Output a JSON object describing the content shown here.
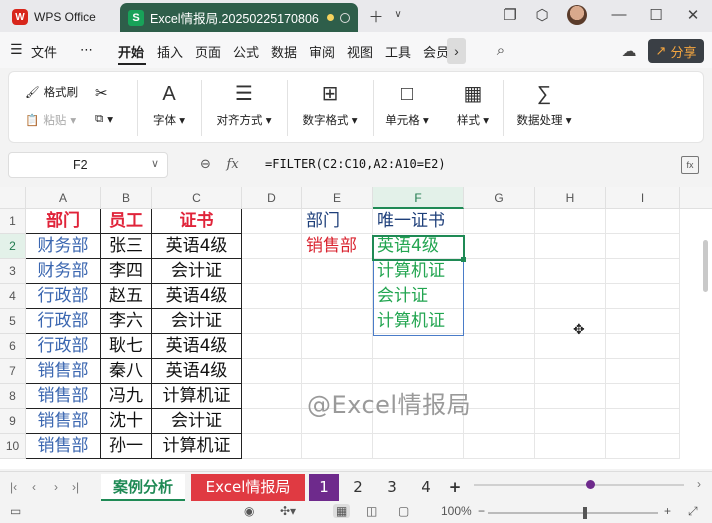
{
  "titlebar": {
    "app_name": "WPS Office",
    "doc_tab": "Excel情报局.20250225170806",
    "icons": [
      "new-tab-icon",
      "dropdown-icon",
      "restore-icon",
      "cube-icon",
      "avatar",
      "minimize-icon",
      "maximize-icon",
      "close-icon"
    ]
  },
  "menubar": {
    "file": "文件",
    "more": "⋯",
    "items": [
      "开始",
      "插入",
      "页面",
      "公式",
      "数据",
      "审阅",
      "视图",
      "工具",
      "会员"
    ],
    "share": "分享"
  },
  "ribbon": {
    "format_painter": "格式刷",
    "paste": "粘贴",
    "font": "字体",
    "align": "对齐方式",
    "number_format": "数字格式",
    "cell": "单元格",
    "style": "样式",
    "data_process": "数据处理"
  },
  "formula_bar": {
    "cell_ref": "F2",
    "fx": "fx",
    "formula": "=FILTER(C2:C10,A2:A10=E2)"
  },
  "grid": {
    "columns": [
      "A",
      "B",
      "C",
      "D",
      "E",
      "F",
      "G",
      "H",
      "I"
    ],
    "rows": [
      "1",
      "2",
      "3",
      "4",
      "5",
      "6",
      "7",
      "8",
      "9",
      "10"
    ],
    "table_headers": [
      "部门",
      "员工",
      "证书"
    ],
    "table_rows": [
      [
        "财务部",
        "张三",
        "英语4级"
      ],
      [
        "财务部",
        "李四",
        "会计证"
      ],
      [
        "行政部",
        "赵五",
        "英语4级"
      ],
      [
        "行政部",
        "李六",
        "会计证"
      ],
      [
        "行政部",
        "耿七",
        "英语4级"
      ],
      [
        "销售部",
        "秦八",
        "英语4级"
      ],
      [
        "销售部",
        "冯九",
        "计算机证"
      ],
      [
        "销售部",
        "沈十",
        "会计证"
      ],
      [
        "销售部",
        "孙一",
        "计算机证"
      ]
    ],
    "e1": "部门",
    "e2": "销售部",
    "f1": "唯一证书",
    "f_results": [
      "英语4级",
      "计算机证",
      "会计证",
      "计算机证"
    ],
    "watermark": "@Excel情报局"
  },
  "sheet_tabs": {
    "tabs": [
      "案例分析",
      "Excel情报局",
      "1",
      "2",
      "3",
      "4"
    ],
    "add": "+"
  },
  "statusbar": {
    "zoom": "100%",
    "zoom_out": "−",
    "zoom_in": "+"
  },
  "colors": {
    "accent_green": "#1f8a55",
    "header_red": "#e0243a",
    "dept_blue": "#3a66b0",
    "result_green": "#22a550",
    "tab_red": "#e03a42",
    "tab_purple": "#6e2a8c"
  }
}
